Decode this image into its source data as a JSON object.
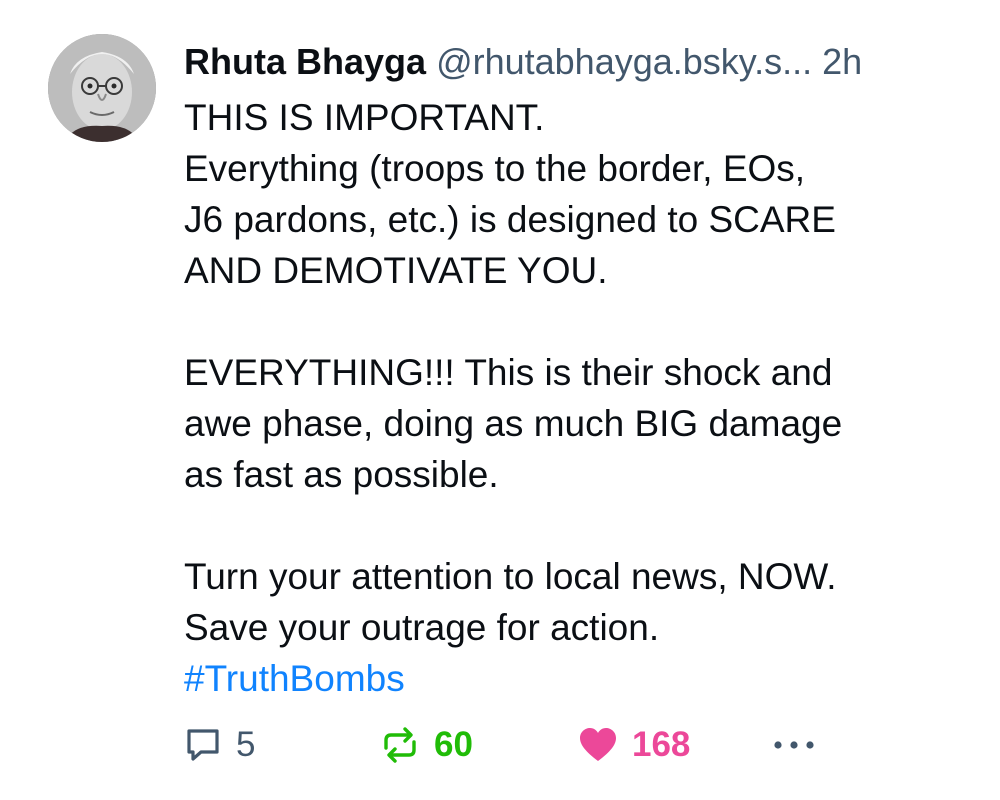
{
  "post": {
    "author": {
      "display_name": "Rhuta Bhayga",
      "handle": "@rhutabhayga.bsky.s...",
      "time_ago": "2h"
    },
    "paragraphs": [
      [
        "THIS IS IMPORTANT.",
        "Everything (troops to the border, EOs,",
        "J6 pardons, etc.) is designed to SCARE",
        "AND DEMOTIVATE YOU."
      ],
      [
        "EVERYTHING!!! This is their shock and",
        "awe phase, doing as much BIG damage",
        "as fast as possible."
      ],
      [
        "Turn your attention to local news, NOW.",
        "Save your outrage for action."
      ]
    ],
    "hashtag": "#TruthBombs",
    "actions": {
      "reply_count": "5",
      "repost_count": "60",
      "like_count": "168"
    }
  },
  "colors": {
    "text": "#0b0f14",
    "muted": "#42576c",
    "link": "#1083fe",
    "repost_active": "#20bc07",
    "like_active": "#ec4899"
  },
  "icons": {
    "reply": "speech-bubble-icon",
    "repost": "repost-arrows-icon",
    "like": "heart-icon",
    "more": "more-dots-icon"
  }
}
